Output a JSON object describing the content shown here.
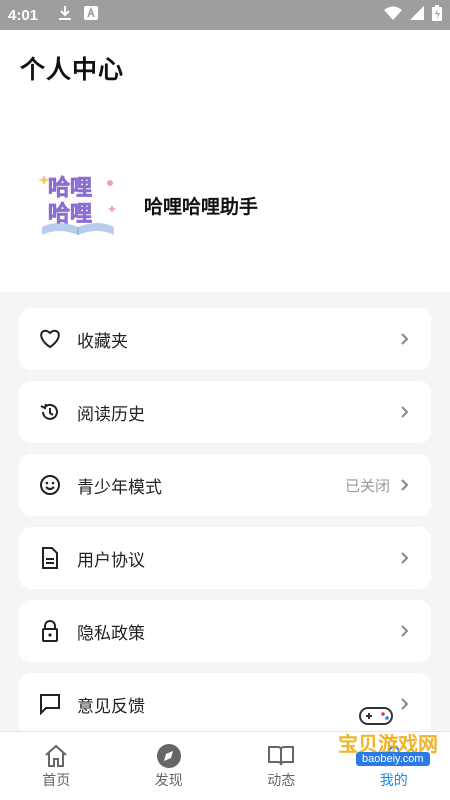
{
  "status_bar": {
    "time": "4:01"
  },
  "header": {
    "title": "个人中心"
  },
  "profile": {
    "name": "哈哩哈哩助手",
    "avatar_text": [
      "哈哩",
      "哈哩"
    ]
  },
  "menu": [
    {
      "label": "收藏夹",
      "icon": "heart-icon"
    },
    {
      "label": "阅读历史",
      "icon": "history-icon"
    },
    {
      "label": "青少年模式",
      "icon": "smile-icon",
      "value": "已关闭"
    },
    {
      "label": "用户协议",
      "icon": "document-icon"
    },
    {
      "label": "隐私政策",
      "icon": "lock-icon"
    },
    {
      "label": "意见反馈",
      "icon": "feedback-icon"
    }
  ],
  "tabbar": [
    {
      "label": "首页",
      "icon": "home-icon"
    },
    {
      "label": "发现",
      "icon": "compass-icon"
    },
    {
      "label": "动态",
      "icon": "book-icon"
    },
    {
      "label": "我的",
      "icon": "user-icon",
      "active": true
    }
  ],
  "watermark": {
    "text": "宝贝游戏网",
    "url": "baobeiy.com"
  },
  "colors": {
    "accent": "#1e88e5",
    "status_bar": "#9e9e9e",
    "background": "#f4f5f7"
  }
}
